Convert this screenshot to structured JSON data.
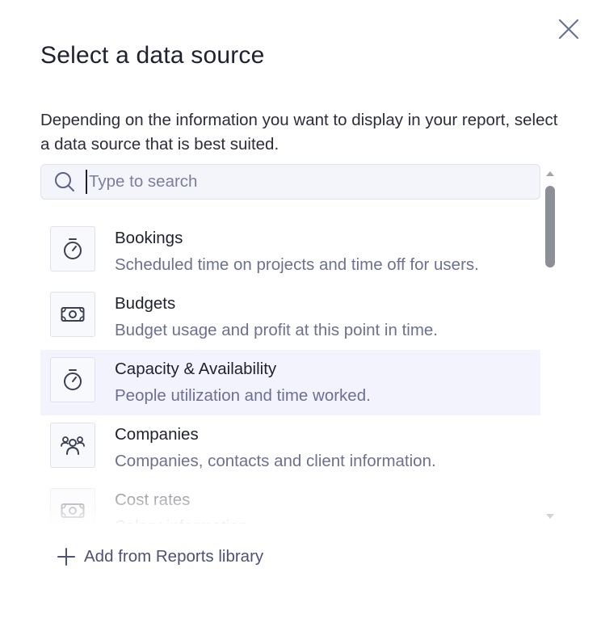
{
  "modal": {
    "title": "Select a data source",
    "description": "Depending on the information you want to display in your report, select a data source that is best suited.",
    "close_icon": "close-icon"
  },
  "search": {
    "placeholder": "Type to search",
    "value": "",
    "icon": "search-icon"
  },
  "data_sources": [
    {
      "title": "Bookings",
      "subtitle": "Scheduled time on projects and time off for users.",
      "icon": "stopwatch-icon"
    },
    {
      "title": "Budgets",
      "subtitle": "Budget usage and profit at this point in time.",
      "icon": "money-icon"
    },
    {
      "title": "Capacity & Availability",
      "subtitle": "People utilization and time worked.",
      "icon": "stopwatch-icon",
      "highlighted": true
    },
    {
      "title": "Companies",
      "subtitle": "Companies, contacts and client information.",
      "icon": "people-group-icon"
    },
    {
      "title": "Cost rates",
      "subtitle": "Salary information",
      "icon": "money-icon"
    }
  ],
  "footer": {
    "add_label": "Add from Reports library",
    "add_icon": "plus-icon"
  },
  "colors": {
    "highlight": "#f2f3fc",
    "subtext": "#6c7092",
    "link": "#4a5375"
  }
}
